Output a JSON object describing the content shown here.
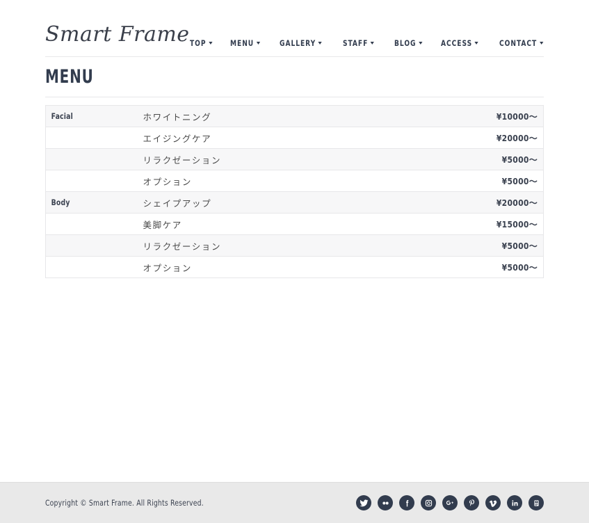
{
  "site": {
    "logo": "Smart Frame"
  },
  "nav": {
    "items": [
      {
        "label": "TOP",
        "has_dropdown": true
      },
      {
        "label": "MENU",
        "has_dropdown": true
      },
      {
        "label": "GALLERY",
        "has_dropdown": true
      },
      {
        "label": "STAFF",
        "has_dropdown": true
      },
      {
        "label": "BLOG",
        "has_dropdown": true
      },
      {
        "label": "ACCESS",
        "has_dropdown": true
      },
      {
        "label": "CONTACT",
        "has_dropdown": true
      }
    ]
  },
  "page": {
    "title": "MENU"
  },
  "menu_table": {
    "rows": [
      {
        "category": "Facial",
        "name": "ホワイトニング",
        "price": "¥10000〜"
      },
      {
        "category": "",
        "name": "エイジングケア",
        "price": "¥20000〜"
      },
      {
        "category": "",
        "name": "リラクゼーション",
        "price": "¥5000〜"
      },
      {
        "category": "",
        "name": "オプション",
        "price": "¥5000〜"
      },
      {
        "category": "Body",
        "name": "シェイプアップ",
        "price": "¥20000〜"
      },
      {
        "category": "",
        "name": "美脚ケア",
        "price": "¥15000〜"
      },
      {
        "category": "",
        "name": "リラクゼーション",
        "price": "¥5000〜"
      },
      {
        "category": "",
        "name": "オプション",
        "price": "¥5000〜"
      }
    ]
  },
  "footer": {
    "copyright": "Copyright © Smart Frame. All Rights Reserved.",
    "social": [
      {
        "name": "twitter-icon"
      },
      {
        "name": "flickr-icon"
      },
      {
        "name": "facebook-icon"
      },
      {
        "name": "instagram-icon"
      },
      {
        "name": "googleplus-icon"
      },
      {
        "name": "pinterest-icon"
      },
      {
        "name": "vimeo-icon"
      },
      {
        "name": "linkedin-icon"
      },
      {
        "name": "youtube-icon"
      }
    ]
  },
  "colors": {
    "navy": "#323c4e",
    "body_text": "#4a4a4a",
    "rule": "#e7e7e9",
    "stripe": "#f7f7f8",
    "footer_bg": "#e9e9e9"
  }
}
